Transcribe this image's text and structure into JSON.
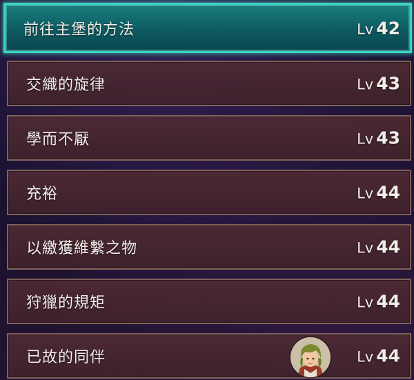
{
  "quests": [
    {
      "name": "前往主堡的方法",
      "lv": "Lv",
      "level": "42",
      "selected": true
    },
    {
      "name": "交織的旋律",
      "lv": "Lv",
      "level": "43"
    },
    {
      "name": "學而不厭",
      "lv": "Lv",
      "level": "43"
    },
    {
      "name": "充裕",
      "lv": "Lv",
      "level": "44"
    },
    {
      "name": "以繳獲維繫之物",
      "lv": "Lv",
      "level": "44"
    },
    {
      "name": "狩獵的規矩",
      "lv": "Lv",
      "level": "44"
    },
    {
      "name": "已故的同伴",
      "lv": "Lv",
      "level": "44",
      "icon": "character-portrait-icon"
    }
  ],
  "colors": {
    "selected_border": "#39d6c0",
    "selected_fill": "#0d5a60",
    "row_fill": "#4e2a34",
    "text": "#f2eee8"
  }
}
